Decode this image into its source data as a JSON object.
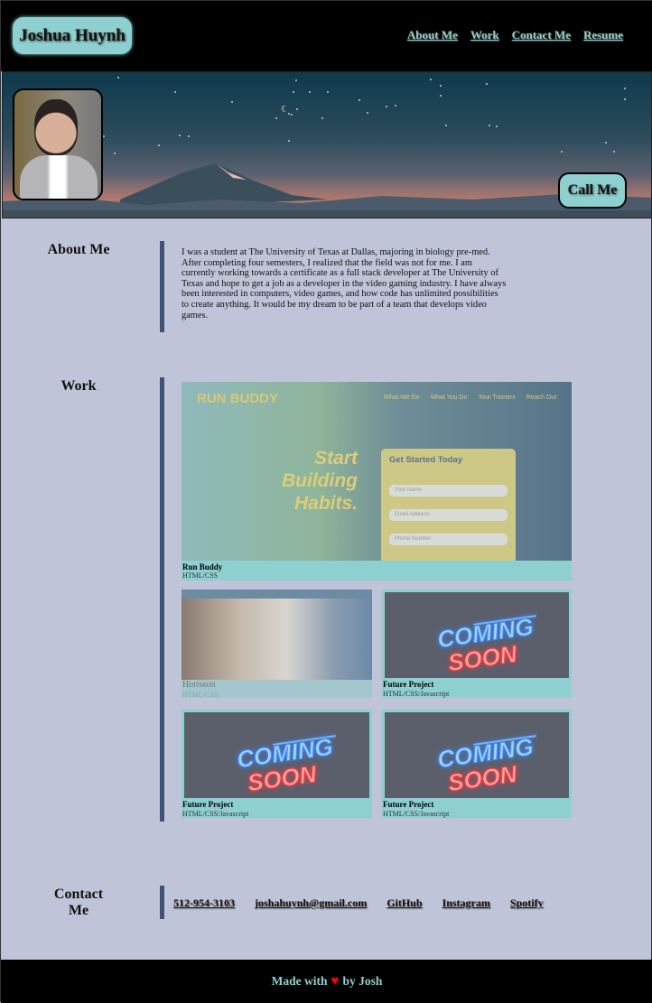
{
  "header": {
    "logo": "Joshua Huynh",
    "nav": [
      "About Me",
      "Work",
      "Contact Me",
      "Resume"
    ]
  },
  "hero": {
    "call_button": "Call Me"
  },
  "about": {
    "heading": "About Me",
    "text": "I was a student at The University of Texas at Dallas, majoring in biology pre-med. After completing four semesters, I realized that the field was not for me. I am currently working towards a certificate as a full stack developer at The University of Texas and hope to get a job as a developer in the video gaming industry. I have always been interested in computers, video games, and how code has unlimited possibilities to create anything. It would be my dream to be part of a team that develops video games."
  },
  "work": {
    "heading": "Work",
    "projects": [
      {
        "title": "Run Buddy",
        "tech": "HTML/CSS"
      },
      {
        "title": "Horiseon",
        "tech": "HTML/CSS"
      },
      {
        "title": "Future Project",
        "tech": "HTML/CSS/Javascript"
      },
      {
        "title": "Future Project",
        "tech": "HTML/CSS/Javascript"
      },
      {
        "title": "Future Project",
        "tech": "HTML/CSS/Javascript"
      }
    ],
    "runbuddy_preview": {
      "brand": "RUN BUDDY",
      "nav": [
        "What We Do",
        "What You Do",
        "Your Trainers",
        "Reach Out"
      ],
      "hero": "Start Building Habits.",
      "form_title": "Get Started Today",
      "fields": [
        "Your Name",
        "Email Address",
        "Phone Number"
      ]
    },
    "coming_soon": [
      "COMING",
      "SOON"
    ]
  },
  "contact": {
    "heading": "Contact Me",
    "links": [
      "512-954-3103",
      "joshahuynh@gmail.com",
      "GitHub",
      "Instagram",
      "Spotify"
    ]
  },
  "footer": {
    "made_with": "Made with",
    "by": "by Josh"
  }
}
